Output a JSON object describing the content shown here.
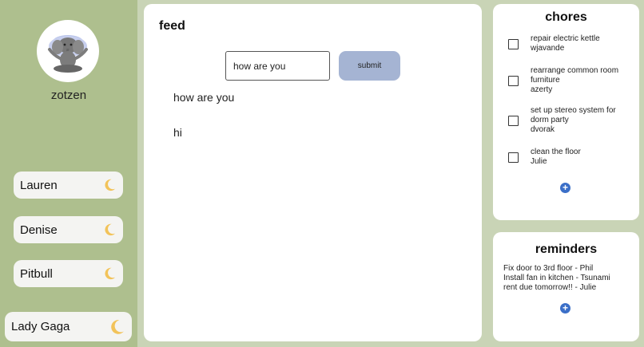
{
  "sidebar": {
    "username": "zotzen",
    "members": [
      {
        "name": "Lauren",
        "status_icon": "moon-icon"
      },
      {
        "name": "Denise",
        "status_icon": "moon-icon"
      },
      {
        "name": "Pitbull",
        "status_icon": "moon-icon"
      },
      {
        "name": "Lady Gaga",
        "status_icon": "moon-icon"
      }
    ]
  },
  "feed": {
    "title": "feed",
    "input_value": "how are you",
    "submit_label": "submit",
    "messages": [
      "how are you",
      "hi"
    ]
  },
  "chores": {
    "title": "chores",
    "items": [
      {
        "task": "repair electric kettle",
        "assignee": "wjavande",
        "checked": false
      },
      {
        "task": "rearrange common room furniture",
        "assignee": "azerty",
        "checked": false
      },
      {
        "task": "set up stereo system for dorm party",
        "assignee": "dvorak",
        "checked": false
      },
      {
        "task": "clean the floor",
        "assignee": "Julie",
        "checked": false
      }
    ],
    "add_label": "+"
  },
  "reminders": {
    "title": "reminders",
    "items": [
      "Fix door to 3rd floor - Phil",
      "Install fan in kitchen - Tsunami",
      "rent due tomorrow!! - Julie"
    ],
    "add_label": "+"
  },
  "colors": {
    "page_bg": "#c9d4b6",
    "sidebar_bg": "#aebf8e",
    "submit_bg": "#a5b4d3",
    "accent_blue": "#3b6fc8",
    "moon": "#f2c35a"
  }
}
